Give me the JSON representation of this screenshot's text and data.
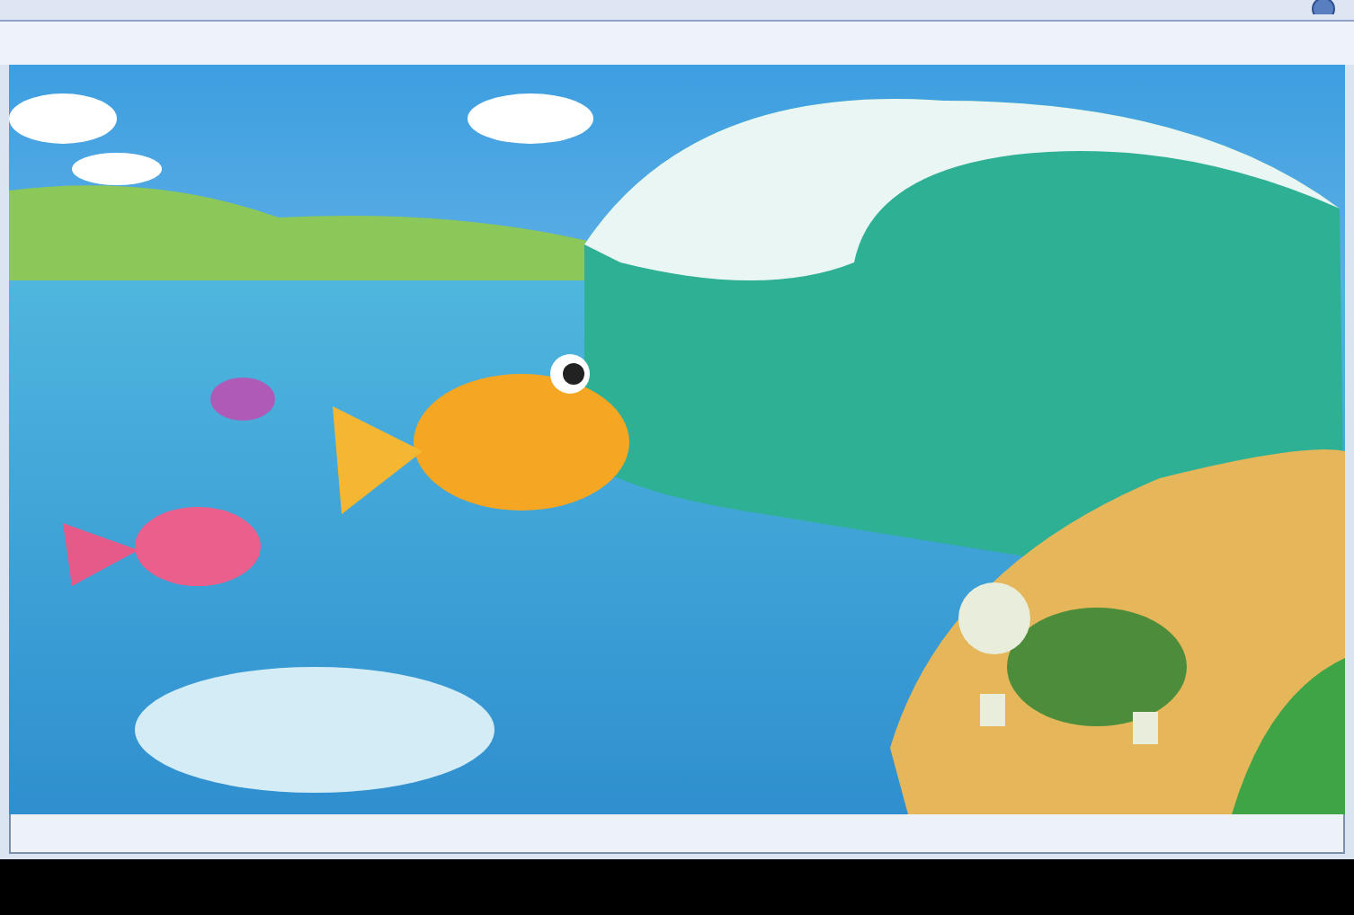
{
  "viewer": {
    "image": {
      "kind": "illustration"
    }
  }
}
